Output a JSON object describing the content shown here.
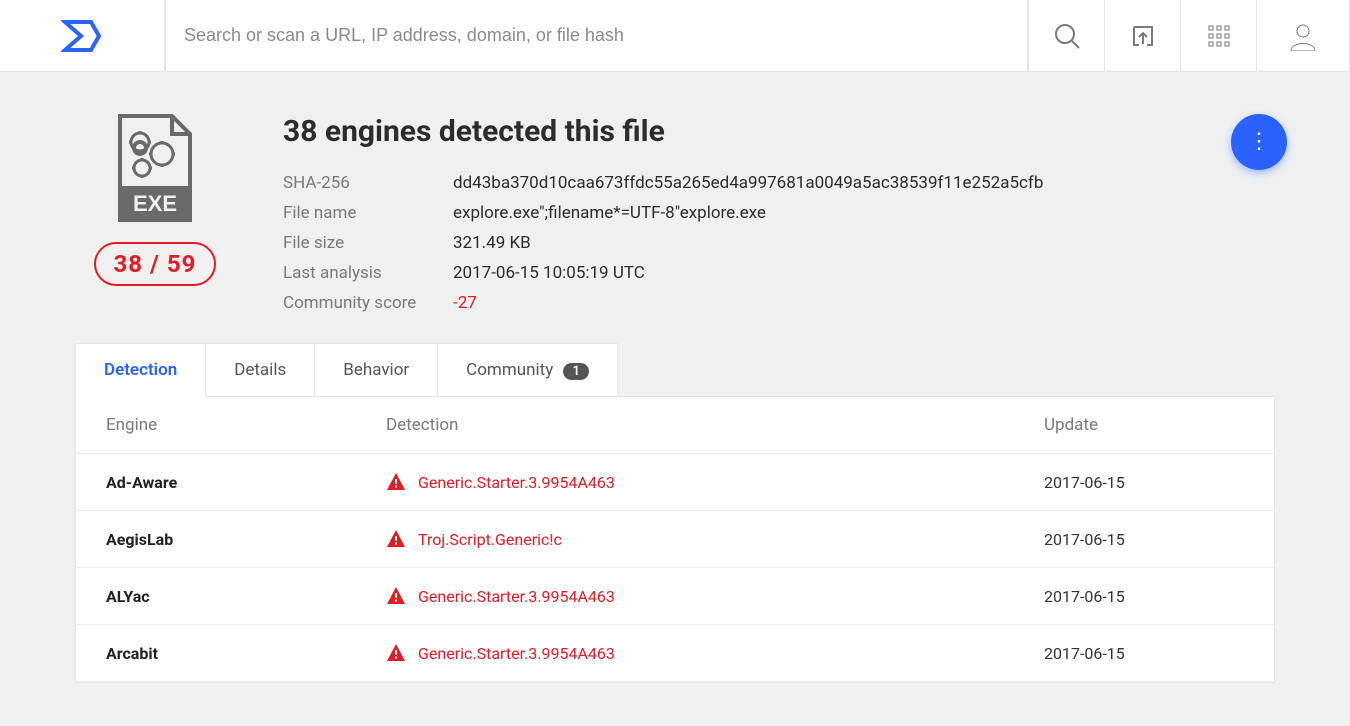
{
  "search": {
    "placeholder": "Search or scan a URL, IP address, domain, or file hash"
  },
  "summary": {
    "score_text": "38 / 59",
    "headline": "38 engines detected this file",
    "rows": {
      "sha256": {
        "label": "SHA-256",
        "value": "dd43ba370d10caa673ffdc55a265ed4a997681a0049a5ac38539f11e252a5cfb"
      },
      "filename": {
        "label": "File name",
        "value": "explore.exe\";filename*=UTF-8\"explore.exe"
      },
      "filesize": {
        "label": "File size",
        "value": "321.49 KB"
      },
      "lastanalysis": {
        "label": "Last analysis",
        "value": "2017-06-15 10:05:19 UTC"
      },
      "community": {
        "label": "Community score",
        "value": "-27"
      }
    }
  },
  "tabs": {
    "detection": "Detection",
    "details": "Details",
    "behavior": "Behavior",
    "community": "Community",
    "community_badge": "1"
  },
  "table": {
    "cols": {
      "engine": "Engine",
      "detection": "Detection",
      "update": "Update"
    },
    "rows": [
      {
        "engine": "Ad-Aware",
        "detection": "Generic.Starter.3.9954A463",
        "update": "2017-06-15"
      },
      {
        "engine": "AegisLab",
        "detection": "Troj.Script.Generic!c",
        "update": "2017-06-15"
      },
      {
        "engine": "ALYac",
        "detection": "Generic.Starter.3.9954A463",
        "update": "2017-06-15"
      },
      {
        "engine": "Arcabit",
        "detection": "Generic.Starter.3.9954A463",
        "update": "2017-06-15"
      }
    ]
  }
}
